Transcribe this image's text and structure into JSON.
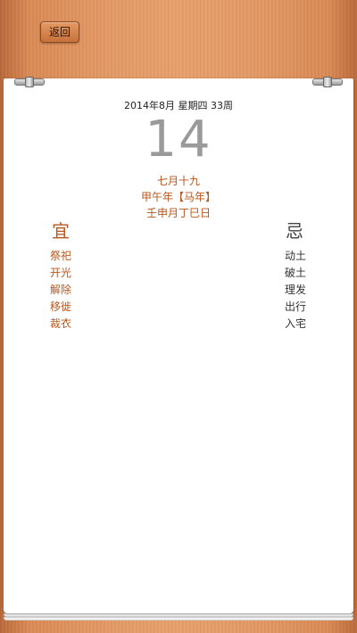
{
  "toolbar": {
    "back_label": "返回"
  },
  "calendar": {
    "date_line": "2014年8月 星期四 33周",
    "day": "14",
    "lunar_date": "七月十九",
    "lunar_year": "甲午年【马年】",
    "ganzhi": "壬申月丁巳日"
  },
  "yi": {
    "title": "宜",
    "items": [
      "祭祀",
      "开光",
      "解除",
      "移徙",
      "裁衣"
    ]
  },
  "ji": {
    "title": "忌",
    "items": [
      "动土",
      "破土",
      "理发",
      "出行",
      "入宅"
    ]
  },
  "colors": {
    "accent": "#b8561e",
    "wood": "#e39a66"
  }
}
